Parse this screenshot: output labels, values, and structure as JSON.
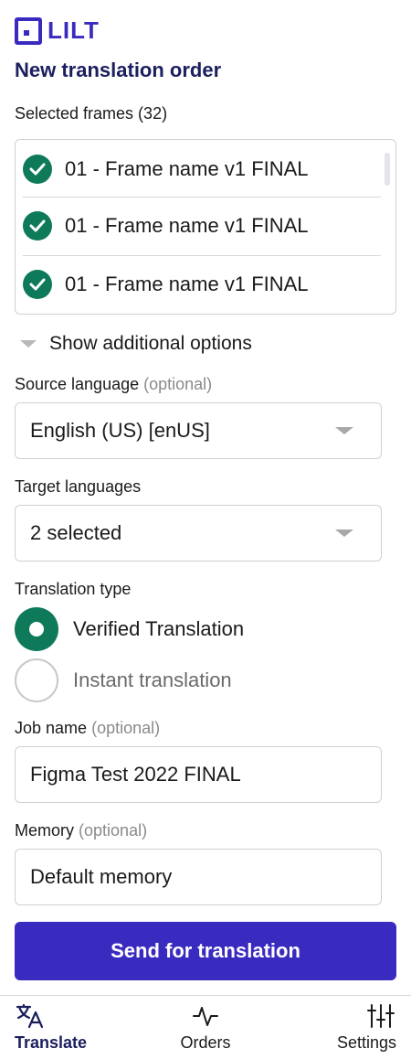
{
  "brand": {
    "name": "LILT",
    "color": "#3a2bc0"
  },
  "page": {
    "title": "New translation order"
  },
  "frames": {
    "label": "Selected frames (32)",
    "items": [
      "01 - Frame name v1 FINAL",
      "01 - Frame name v1 FINAL",
      "01 - Frame name v1 FINAL"
    ]
  },
  "options_toggle": {
    "label": "Show additional options"
  },
  "source_language": {
    "label": "Source language",
    "optional": "(optional)",
    "value": "English (US) [enUS]"
  },
  "target_languages": {
    "label": "Target languages",
    "value": "2 selected"
  },
  "translation_type": {
    "label": "Translation type",
    "options": [
      {
        "label": "Verified Translation",
        "selected": true
      },
      {
        "label": "Instant translation",
        "selected": false
      }
    ]
  },
  "job_name": {
    "label": "Job name",
    "optional": "(optional)",
    "value": "Figma Test 2022 FINAL"
  },
  "memory": {
    "label": "Memory",
    "optional": "(optional)",
    "value": "Default memory"
  },
  "submit": {
    "label": "Send for translation"
  },
  "nav": [
    {
      "label": "Translate",
      "icon": "translate-icon",
      "active": true
    },
    {
      "label": "Orders",
      "icon": "activity-icon",
      "active": false
    },
    {
      "label": "Settings",
      "icon": "sliders-icon",
      "active": false
    }
  ],
  "colors": {
    "accent": "#3a2bc0",
    "success": "#0e7a5a",
    "title": "#1b1f5e"
  }
}
